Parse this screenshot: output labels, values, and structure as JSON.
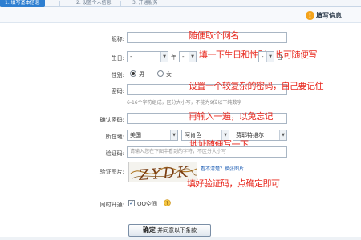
{
  "tabs": [
    {
      "label": "1. 填写基本信息",
      "active": true
    },
    {
      "label": "2. 设置个人信息",
      "active": false
    },
    {
      "label": "3. 开通服务",
      "active": false
    }
  ],
  "infobar": {
    "icon": "info-icon",
    "label": "填写信息"
  },
  "nickname": {
    "label": "昵称:",
    "value": "",
    "annotation": "随便取个网名"
  },
  "birthday": {
    "label": "生日:",
    "year_value": "-",
    "year_unit": "年",
    "month_value": "-",
    "month_unit": "月",
    "day_value": "-",
    "day_unit": "日",
    "annotation": "填一下生日和性别，也可随便写"
  },
  "gender": {
    "label": "性别:",
    "male": "男",
    "female": "女",
    "selected": "male"
  },
  "password": {
    "label": "密码:",
    "value": "",
    "hint": "6-16个字符组成，区分大小写，不能为9位以下纯数字",
    "annotation": "设置一个较复杂的密码，自己要记住"
  },
  "confirm_password": {
    "label": "确认密码:",
    "value": "",
    "annotation": "再输入一遍，以免忘记"
  },
  "location": {
    "label": "所在地:",
    "country": "美国",
    "state": "阿肯色",
    "city": "费耶特维尔",
    "annotation": "地址随便写一下"
  },
  "captcha_input": {
    "label": "验证码:",
    "placeholder": "请输入您在下图中看到的字符，不区分大小写"
  },
  "captcha_image": {
    "label": "验证图片:",
    "text": "ZYDK",
    "refresh_link": "看不清楚？换张图片",
    "annotation": "填好验证码，点确定即可"
  },
  "services": {
    "label": "同时开通:",
    "checked": true,
    "qzone_label": "QQ空间",
    "icon": "help-icon"
  },
  "submit": {
    "primary": "确定",
    "secondary": "并同意以下条款"
  },
  "colors": {
    "annotation": "#e8281e",
    "tab_active": "#2e7fd1",
    "link": "#2966b8"
  }
}
